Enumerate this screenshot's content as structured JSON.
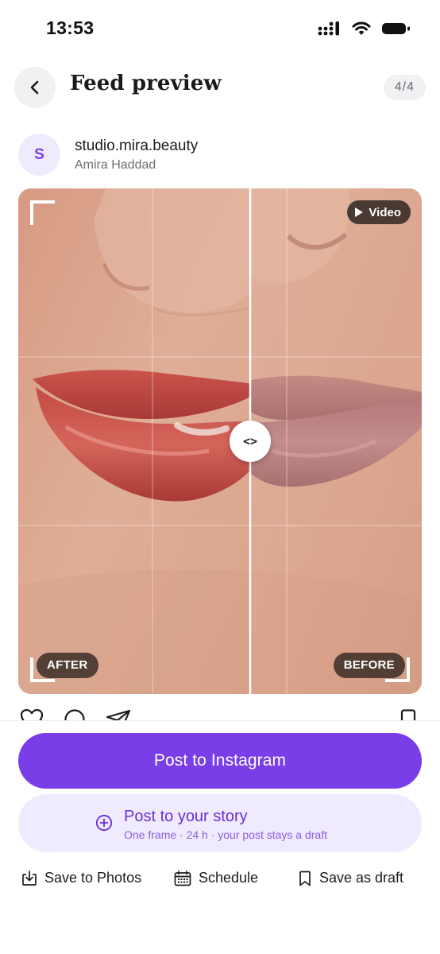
{
  "status_bar": {
    "time": "13:53"
  },
  "header": {
    "back_icon": "chevron-left-icon",
    "title": "Feed preview",
    "counter": "4/4"
  },
  "account": {
    "avatar_initial": "S",
    "handle": "studio.mira.beauty",
    "owner": "Amira Haddad"
  },
  "media": {
    "video_badge": "Video",
    "slider_handle": "<>",
    "after_label": "AFTER",
    "before_label": "BEFORE",
    "colors": {
      "after_lip": "#c84a43",
      "before_lip": "#b9797b",
      "skin": "#dba992"
    }
  },
  "actions": {
    "post_instagram": "Post to Instagram",
    "post_story_title": "Post to your story",
    "post_story_subtitle": "One frame · 24 h · your post stays a draft",
    "save_photos": "Save to Photos",
    "schedule": "Schedule",
    "save_draft": "Save as draft"
  },
  "colors": {
    "accent": "#7a3ee8",
    "accent_soft": "#efeafd"
  }
}
